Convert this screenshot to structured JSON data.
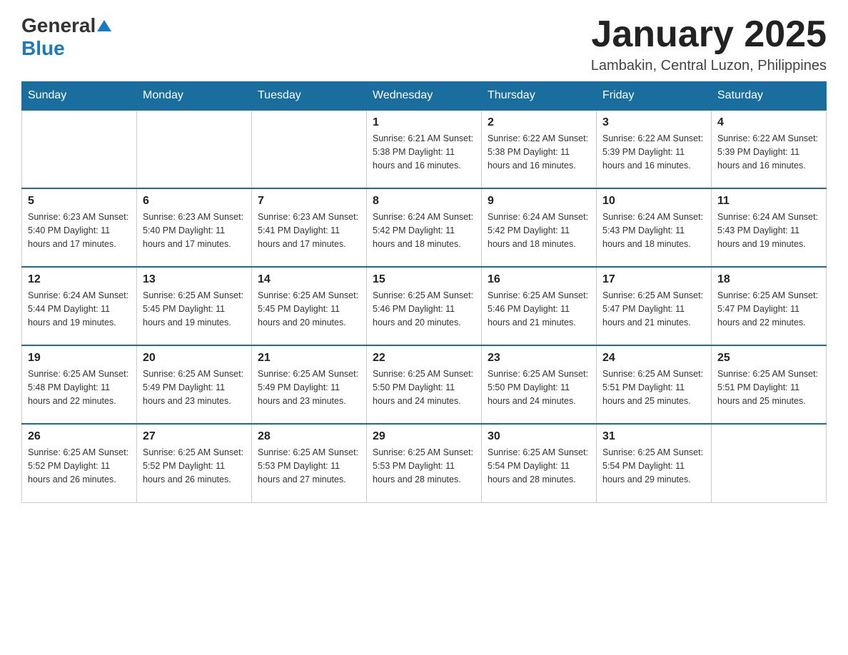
{
  "header": {
    "logo": {
      "general": "General",
      "blue": "Blue"
    },
    "title": "January 2025",
    "location": "Lambakin, Central Luzon, Philippines"
  },
  "days_of_week": [
    "Sunday",
    "Monday",
    "Tuesday",
    "Wednesday",
    "Thursday",
    "Friday",
    "Saturday"
  ],
  "weeks": [
    [
      {
        "day": "",
        "info": ""
      },
      {
        "day": "",
        "info": ""
      },
      {
        "day": "",
        "info": ""
      },
      {
        "day": "1",
        "info": "Sunrise: 6:21 AM\nSunset: 5:38 PM\nDaylight: 11 hours\nand 16 minutes."
      },
      {
        "day": "2",
        "info": "Sunrise: 6:22 AM\nSunset: 5:38 PM\nDaylight: 11 hours\nand 16 minutes."
      },
      {
        "day": "3",
        "info": "Sunrise: 6:22 AM\nSunset: 5:39 PM\nDaylight: 11 hours\nand 16 minutes."
      },
      {
        "day": "4",
        "info": "Sunrise: 6:22 AM\nSunset: 5:39 PM\nDaylight: 11 hours\nand 16 minutes."
      }
    ],
    [
      {
        "day": "5",
        "info": "Sunrise: 6:23 AM\nSunset: 5:40 PM\nDaylight: 11 hours\nand 17 minutes."
      },
      {
        "day": "6",
        "info": "Sunrise: 6:23 AM\nSunset: 5:40 PM\nDaylight: 11 hours\nand 17 minutes."
      },
      {
        "day": "7",
        "info": "Sunrise: 6:23 AM\nSunset: 5:41 PM\nDaylight: 11 hours\nand 17 minutes."
      },
      {
        "day": "8",
        "info": "Sunrise: 6:24 AM\nSunset: 5:42 PM\nDaylight: 11 hours\nand 18 minutes."
      },
      {
        "day": "9",
        "info": "Sunrise: 6:24 AM\nSunset: 5:42 PM\nDaylight: 11 hours\nand 18 minutes."
      },
      {
        "day": "10",
        "info": "Sunrise: 6:24 AM\nSunset: 5:43 PM\nDaylight: 11 hours\nand 18 minutes."
      },
      {
        "day": "11",
        "info": "Sunrise: 6:24 AM\nSunset: 5:43 PM\nDaylight: 11 hours\nand 19 minutes."
      }
    ],
    [
      {
        "day": "12",
        "info": "Sunrise: 6:24 AM\nSunset: 5:44 PM\nDaylight: 11 hours\nand 19 minutes."
      },
      {
        "day": "13",
        "info": "Sunrise: 6:25 AM\nSunset: 5:45 PM\nDaylight: 11 hours\nand 19 minutes."
      },
      {
        "day": "14",
        "info": "Sunrise: 6:25 AM\nSunset: 5:45 PM\nDaylight: 11 hours\nand 20 minutes."
      },
      {
        "day": "15",
        "info": "Sunrise: 6:25 AM\nSunset: 5:46 PM\nDaylight: 11 hours\nand 20 minutes."
      },
      {
        "day": "16",
        "info": "Sunrise: 6:25 AM\nSunset: 5:46 PM\nDaylight: 11 hours\nand 21 minutes."
      },
      {
        "day": "17",
        "info": "Sunrise: 6:25 AM\nSunset: 5:47 PM\nDaylight: 11 hours\nand 21 minutes."
      },
      {
        "day": "18",
        "info": "Sunrise: 6:25 AM\nSunset: 5:47 PM\nDaylight: 11 hours\nand 22 minutes."
      }
    ],
    [
      {
        "day": "19",
        "info": "Sunrise: 6:25 AM\nSunset: 5:48 PM\nDaylight: 11 hours\nand 22 minutes."
      },
      {
        "day": "20",
        "info": "Sunrise: 6:25 AM\nSunset: 5:49 PM\nDaylight: 11 hours\nand 23 minutes."
      },
      {
        "day": "21",
        "info": "Sunrise: 6:25 AM\nSunset: 5:49 PM\nDaylight: 11 hours\nand 23 minutes."
      },
      {
        "day": "22",
        "info": "Sunrise: 6:25 AM\nSunset: 5:50 PM\nDaylight: 11 hours\nand 24 minutes."
      },
      {
        "day": "23",
        "info": "Sunrise: 6:25 AM\nSunset: 5:50 PM\nDaylight: 11 hours\nand 24 minutes."
      },
      {
        "day": "24",
        "info": "Sunrise: 6:25 AM\nSunset: 5:51 PM\nDaylight: 11 hours\nand 25 minutes."
      },
      {
        "day": "25",
        "info": "Sunrise: 6:25 AM\nSunset: 5:51 PM\nDaylight: 11 hours\nand 25 minutes."
      }
    ],
    [
      {
        "day": "26",
        "info": "Sunrise: 6:25 AM\nSunset: 5:52 PM\nDaylight: 11 hours\nand 26 minutes."
      },
      {
        "day": "27",
        "info": "Sunrise: 6:25 AM\nSunset: 5:52 PM\nDaylight: 11 hours\nand 26 minutes."
      },
      {
        "day": "28",
        "info": "Sunrise: 6:25 AM\nSunset: 5:53 PM\nDaylight: 11 hours\nand 27 minutes."
      },
      {
        "day": "29",
        "info": "Sunrise: 6:25 AM\nSunset: 5:53 PM\nDaylight: 11 hours\nand 28 minutes."
      },
      {
        "day": "30",
        "info": "Sunrise: 6:25 AM\nSunset: 5:54 PM\nDaylight: 11 hours\nand 28 minutes."
      },
      {
        "day": "31",
        "info": "Sunrise: 6:25 AM\nSunset: 5:54 PM\nDaylight: 11 hours\nand 29 minutes."
      },
      {
        "day": "",
        "info": ""
      }
    ]
  ]
}
